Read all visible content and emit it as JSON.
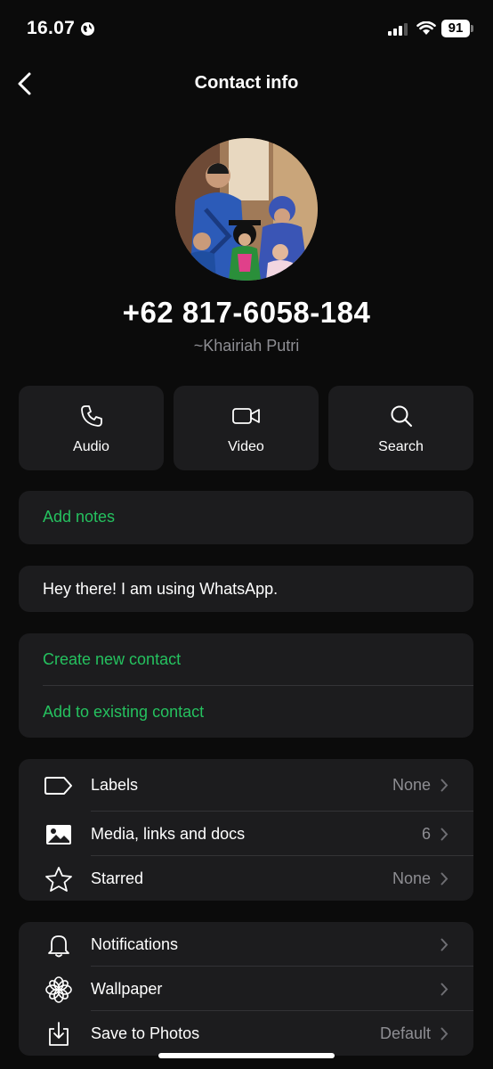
{
  "status_bar": {
    "time": "16.07",
    "battery": "91"
  },
  "nav": {
    "title": "Contact info"
  },
  "contact": {
    "phone": "+62 817-6058-184",
    "name": "~Khairiah Putri"
  },
  "actions": [
    {
      "label": "Audio",
      "icon": "phone-icon"
    },
    {
      "label": "Video",
      "icon": "video-icon"
    },
    {
      "label": "Search",
      "icon": "search-icon"
    }
  ],
  "notes": {
    "label": "Add notes"
  },
  "about": {
    "text": "Hey there! I am using WhatsApp."
  },
  "contact_actions": {
    "create": "Create new contact",
    "add_existing": "Add to existing contact"
  },
  "info_rows": [
    {
      "label": "Labels",
      "value": "None",
      "icon": "label-icon"
    },
    {
      "label": "Media, links and docs",
      "value": "6",
      "icon": "image-icon"
    },
    {
      "label": "Starred",
      "value": "None",
      "icon": "star-icon"
    }
  ],
  "settings_rows": [
    {
      "label": "Notifications",
      "value": "",
      "icon": "bell-icon"
    },
    {
      "label": "Wallpaper",
      "value": "",
      "icon": "flower-icon"
    },
    {
      "label": "Save to Photos",
      "value": "Default",
      "icon": "download-icon"
    }
  ],
  "colors": {
    "accent": "#25c15f",
    "card": "#1c1c1e",
    "background": "#0b0b0b",
    "secondary_text": "#8e8e93"
  }
}
